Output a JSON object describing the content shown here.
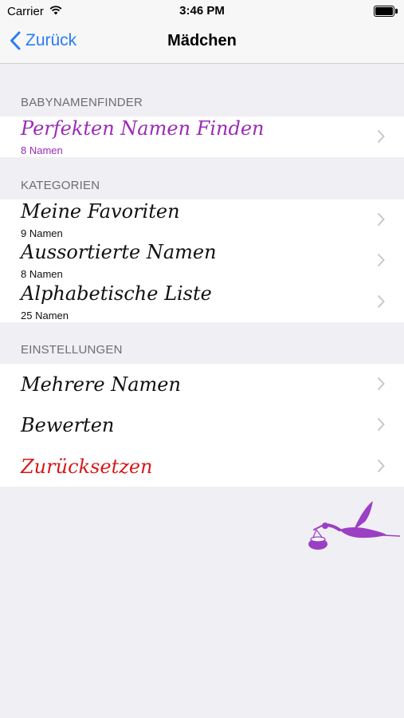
{
  "status_bar": {
    "carrier": "Carrier",
    "time": "3:46 PM"
  },
  "nav": {
    "back_label": "Zurück",
    "title": "Mädchen"
  },
  "sections": {
    "finder": {
      "header": "BABYNAMENFINDER",
      "items": [
        {
          "title": "Perfekten Namen Finden",
          "subtitle": "8 Namen"
        }
      ]
    },
    "categories": {
      "header": "KATEGORIEN",
      "items": [
        {
          "title": "Meine Favoriten",
          "subtitle": "9 Namen"
        },
        {
          "title": "Aussortierte Namen",
          "subtitle": "8 Namen"
        },
        {
          "title": "Alphabetische Liste",
          "subtitle": "25 Namen"
        }
      ]
    },
    "settings": {
      "header": "EINSTELLUNGEN",
      "items": [
        {
          "title": "Mehrere Namen"
        },
        {
          "title": "Bewerten"
        },
        {
          "title": "Zurücksetzen"
        }
      ]
    }
  },
  "colors": {
    "accent_blue": "#2a7df5",
    "purple": "#9b2bb6",
    "red": "#d61a1a",
    "background": "#efeff4"
  },
  "icons": {
    "back": "chevron-left-icon",
    "row": "chevron-right-icon",
    "decor": "stork-icon"
  }
}
